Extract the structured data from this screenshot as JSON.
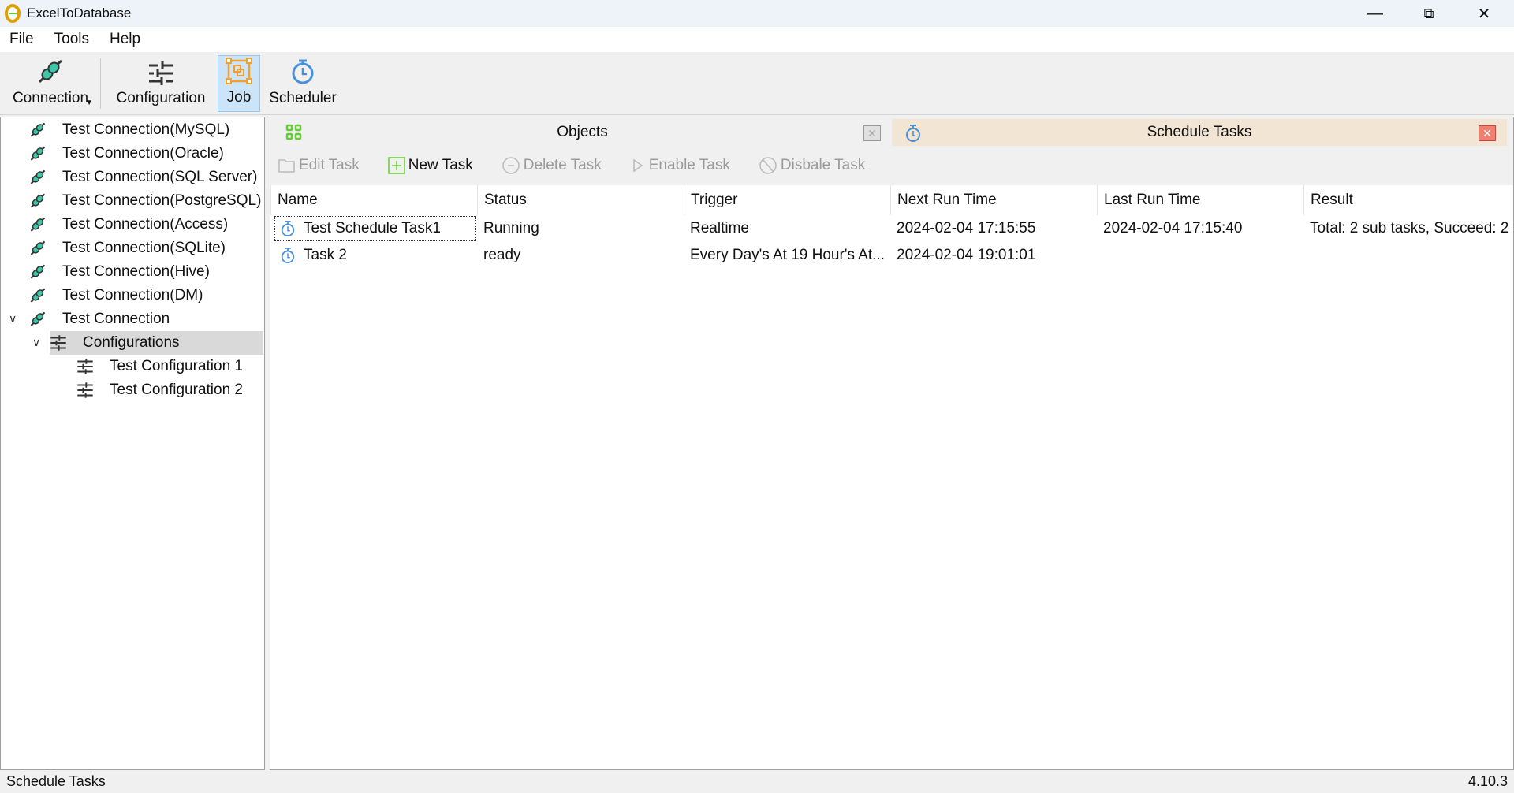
{
  "window": {
    "title": "ExcelToDatabase"
  },
  "menu": [
    "File",
    "Tools",
    "Help"
  ],
  "toolbar": {
    "connection": "Connection",
    "configuration": "Configuration",
    "job": "Job",
    "scheduler": "Scheduler"
  },
  "tree": {
    "connections": [
      "Test Connection(MySQL)",
      "Test Connection(Oracle)",
      "Test Connection(SQL Server)",
      "Test Connection(PostgreSQL)",
      "Test Connection(Access)",
      "Test Connection(SQLite)",
      "Test Connection(Hive)",
      "Test Connection(DM)",
      "Test Connection"
    ],
    "configurations_folder": "Configurations",
    "configurations": [
      "Test Configuration 1",
      "Test Configuration 2"
    ]
  },
  "tabs": [
    {
      "label": "Objects",
      "active": false
    },
    {
      "label": "Schedule Tasks",
      "active": true
    }
  ],
  "actions": {
    "edit": "Edit Task",
    "new": "New Task",
    "delete": "Delete Task",
    "enable": "Enable Task",
    "disable": "Disbale Task"
  },
  "table": {
    "columns": [
      "Name",
      "Status",
      "Trigger",
      "Next Run Time",
      "Last Run Time",
      "Result"
    ],
    "rows": [
      [
        "Test Schedule Task1",
        "Running",
        "Realtime",
        "2024-02-04 17:15:55",
        "2024-02-04 17:15:40",
        "Total: 2 sub tasks, Succeed: 2"
      ],
      [
        "Task 2",
        "ready",
        "Every Day's At 19 Hour's At...",
        "2024-02-04 19:01:01",
        "",
        ""
      ]
    ]
  },
  "status": {
    "left": "Schedule Tasks",
    "version": "4.10.3"
  },
  "colors": {
    "accent": "#4a90d9",
    "job": "#f0a030",
    "tab_active": "#f3e5d4",
    "close_active": "#e06060"
  }
}
